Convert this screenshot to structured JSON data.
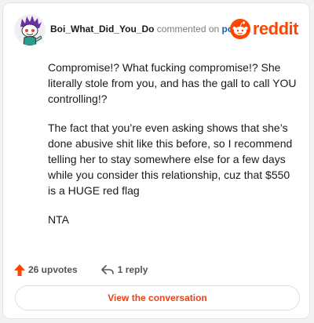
{
  "comment": {
    "author": "Boi_What_Did_You_Do",
    "verb": "commented on",
    "target_link": "post",
    "paragraphs": [
      "Compromise!? What fucking compromise!? She literally stole from you, and has the gall to call YOU controlling!?",
      "The fact that you’re even asking shows that she’s done abusive shit like this before, so I recommend telling her to stay somewhere else for a few days while you consider this relationship, cuz that $550 is a HUGE red flag",
      "NTA"
    ]
  },
  "brand": {
    "wordmark": "reddit",
    "icon": "reddit-logo-icon",
    "color": "#ff4500"
  },
  "actions": {
    "upvotes": "26 upvotes",
    "upvote_icon": "upvote-arrow-icon",
    "upvote_color": "#ff4500",
    "replies": "1 reply",
    "reply_icon": "reply-arrow-icon"
  },
  "cta": {
    "label": "View the conversation",
    "color": "#e8441a"
  },
  "avatar": {
    "icon": "snoo-avatar-icon"
  }
}
